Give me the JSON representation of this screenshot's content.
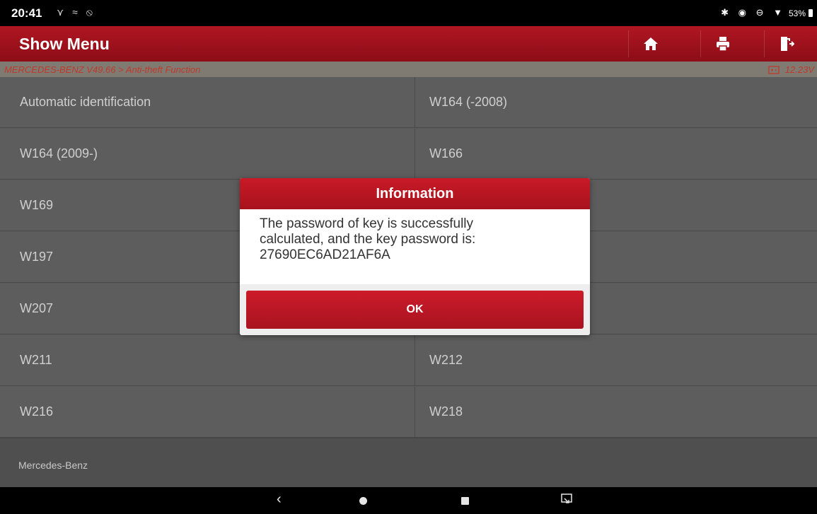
{
  "status": {
    "time": "20:41",
    "left_icons": "⋎ ≈ ⦸",
    "right_icons": "✱ ◉ ⊖ ▼",
    "battery": "53%"
  },
  "header": {
    "title": "Show Menu",
    "buttons": [
      "home-icon",
      "print-icon",
      "exit-icon"
    ],
    "breadcrumb": "MERCEDES-BENZ V49.66 > Anti-theft Function",
    "voltage": "12.23V"
  },
  "menu": {
    "items": [
      {
        "left": "Automatic identification",
        "right": "W164 (-2008)"
      },
      {
        "left": "W164 (2009-)",
        "right": "W166"
      },
      {
        "left": "W169",
        "right": ""
      },
      {
        "left": "W197",
        "right": ""
      },
      {
        "left": "W207",
        "right": ""
      },
      {
        "left": "W211",
        "right": "W212"
      },
      {
        "left": "W216",
        "right": "W218"
      }
    ]
  },
  "footer": {
    "brand": "Mercedes-Benz"
  },
  "dialog": {
    "title": "Information",
    "line1": "The password of key is successfully",
    "line2": "calculated, and the key password is:",
    "line3": "27690EC6AD21AF6A",
    "ok_label": "OK"
  },
  "colors": {
    "accent": "#b01622",
    "crumb": "#c0392b"
  }
}
